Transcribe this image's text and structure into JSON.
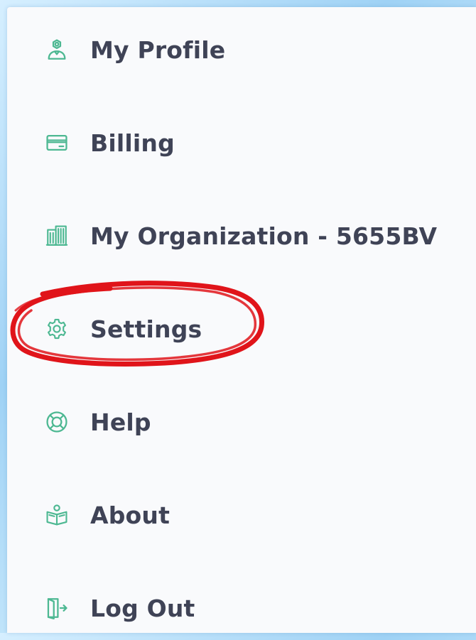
{
  "menu": {
    "items": [
      {
        "label": "My Profile",
        "icon": "user-profile-icon"
      },
      {
        "label": "Billing",
        "icon": "credit-card-icon"
      },
      {
        "label": "My Organization - 5655BV",
        "icon": "building-icon"
      },
      {
        "label": "Settings",
        "icon": "gear-icon"
      },
      {
        "label": "Help",
        "icon": "lifebuoy-icon"
      },
      {
        "label": "About",
        "icon": "book-reader-icon"
      },
      {
        "label": "Log Out",
        "icon": "logout-door-icon"
      }
    ]
  },
  "theme": {
    "icon_color": "#4db892",
    "text_color": "#3f4356",
    "annotation_color": "#e0141a"
  }
}
